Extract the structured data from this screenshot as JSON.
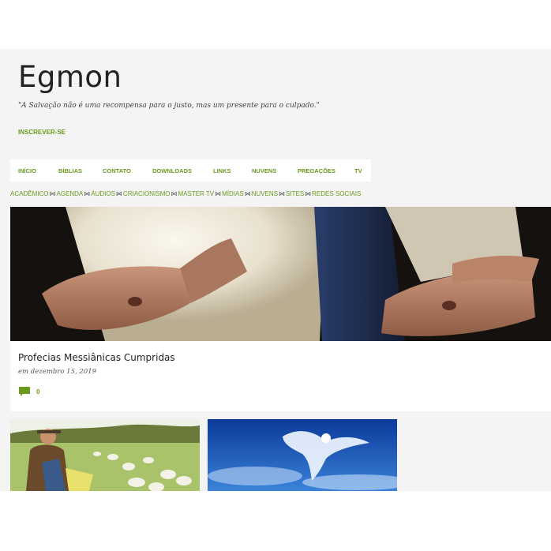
{
  "header": {
    "title": "Egmon",
    "tagline": "\"A Salvação não é uma recompensa para o justo, mas um presente para o culpado.\"",
    "subscribe_label": "INSCREVER-SE"
  },
  "main_nav": [
    "INÍCIO",
    "BÍBLIAS",
    "CONTATO",
    "DOWNLOADS",
    "LINKS",
    "NUVENS",
    "PREGAÇÕES",
    "TV"
  ],
  "sub_nav": [
    "ACADÊMICO",
    "AGENDA",
    "ÁUDIOS",
    "CRIACIONISMO",
    "MASTER TV",
    "MÍDIAS",
    "NUVENS",
    "SITES",
    "REDES SOCIAIS"
  ],
  "featured_post": {
    "title": "Profecias Messiânicas Cumpridas",
    "date": "em dezembro 15, 2019",
    "comment_count": "0",
    "image_icon": "jesus-open-hands-image"
  },
  "post_thumbnails": [
    {
      "image_icon": "shepherd-with-sheep-image"
    },
    {
      "image_icon": "angel-clouds-sky-image"
    }
  ],
  "colors": {
    "accent": "#6a9a1f",
    "page_background": "#f4f4f4",
    "card_background": "#ffffff",
    "title_text": "#222222"
  },
  "icons": {
    "comment": "comment-icon",
    "separator": "bowtie-separator-icon"
  }
}
